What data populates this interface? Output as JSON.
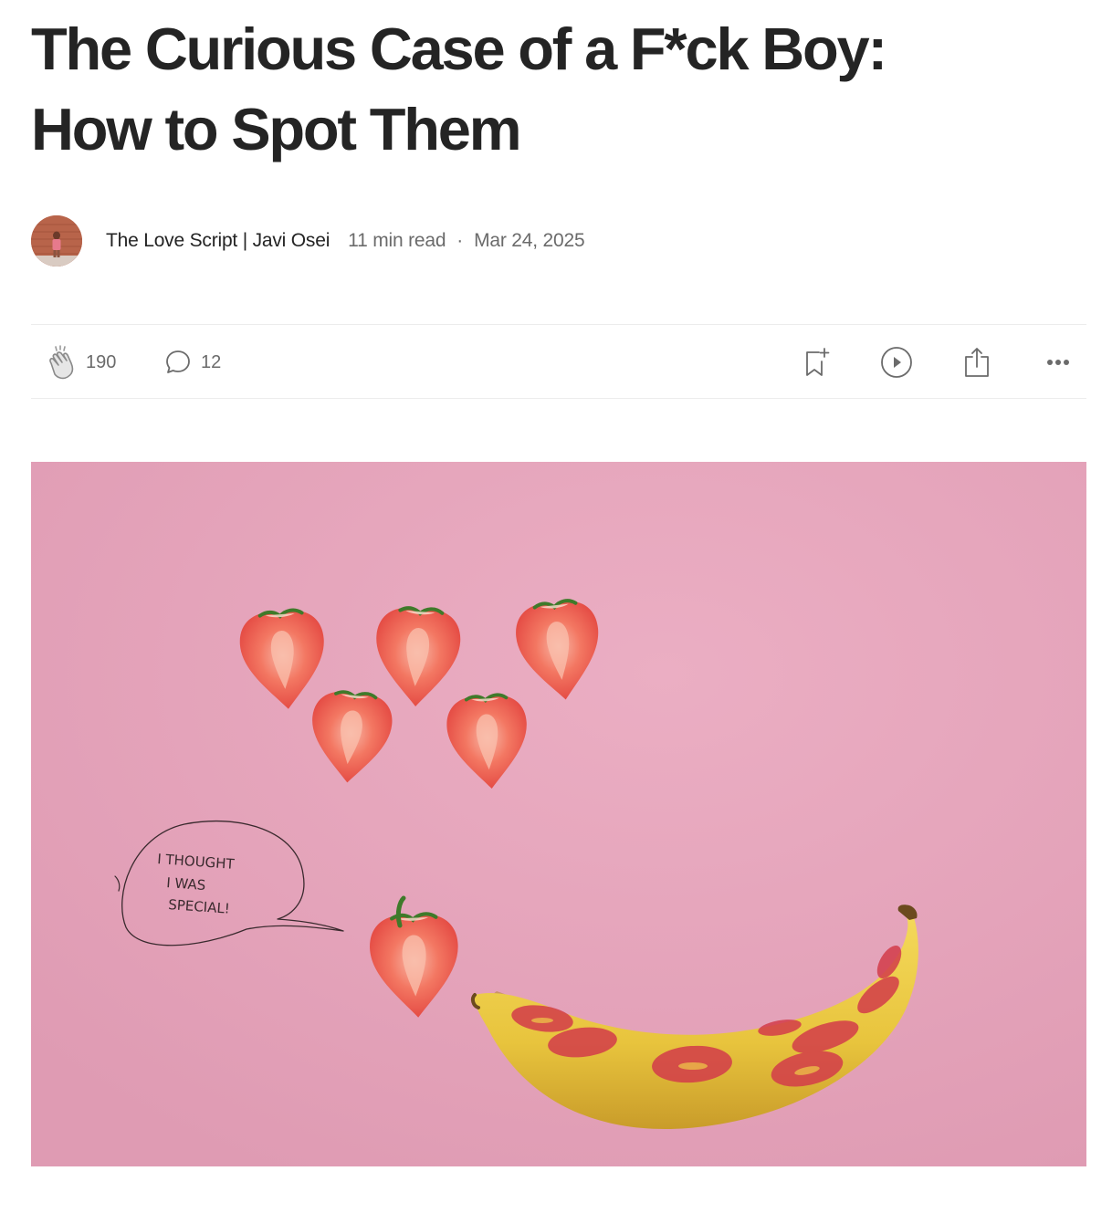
{
  "article": {
    "title_line1": "The Curious Case of a F*ck Boy:",
    "title_line2": "How to Spot Them",
    "author": "The Love Script | Javi Osei",
    "read_time": "11 min read",
    "separator": "·",
    "date": "Mar 24, 2025"
  },
  "actions": {
    "claps": "190",
    "responses": "12",
    "icons": [
      "clap-icon",
      "comment-icon",
      "bookmark-add-icon",
      "play-icon",
      "share-icon",
      "more-icon"
    ]
  },
  "hero_image": {
    "background_color": "#e6a6bd",
    "handwritten_note_line1": "I THOUGHT",
    "handwritten_note_line2": "I WAS",
    "handwritten_note_line3": "SPECIAL!"
  },
  "colors": {
    "text": "#242424",
    "muted": "#6b6b6b",
    "divider": "#ececec"
  }
}
